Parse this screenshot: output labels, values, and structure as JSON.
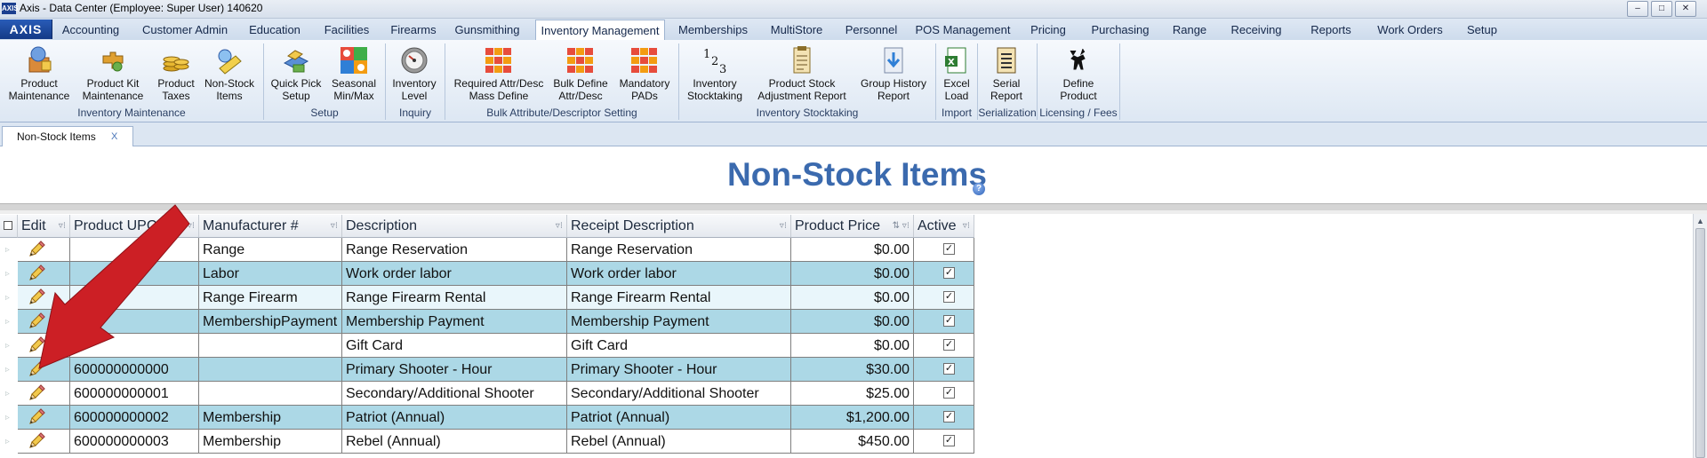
{
  "window": {
    "title": "Axis - Data Center  (Employee: Super User) 140620",
    "app_icon": "AXIS",
    "minimize": "–",
    "maximize": "□",
    "close": "✕"
  },
  "menu": {
    "axis_label": "AXIS",
    "tabs": [
      "Accounting",
      "Customer Admin",
      "Education",
      "Facilities",
      "Firearms",
      "Gunsmithing",
      "Inventory Management",
      "Memberships",
      "MultiStore",
      "Personnel",
      "POS Management",
      "Pricing",
      "Purchasing",
      "Range",
      "Receiving",
      "Reports",
      "Work Orders",
      "Setup"
    ],
    "active_tab": "Inventory Management"
  },
  "ribbon": {
    "buttons": [
      {
        "line1": "Product",
        "line2": "Maintenance",
        "icon": "product-maintenance-icon"
      },
      {
        "line1": "Product Kit",
        "line2": "Maintenance",
        "icon": "product-kit-icon"
      },
      {
        "line1": "Product",
        "line2": "Taxes",
        "icon": "coins-icon"
      },
      {
        "line1": "Non-Stock",
        "line2": "Items",
        "icon": "non-stock-items-icon"
      },
      {
        "line1": "Quick Pick",
        "line2": "Setup",
        "icon": "quick-pick-icon"
      },
      {
        "line1": "Seasonal",
        "line2": "Min/Max",
        "icon": "seasonal-icon"
      },
      {
        "line1": "Inventory",
        "line2": "Level",
        "icon": "gauge-icon"
      },
      {
        "line1": "Required Attr/Desc",
        "line2": "Mass Define",
        "icon": "grid-icon"
      },
      {
        "line1": "Bulk Define",
        "line2": "Attr/Desc",
        "icon": "grid-icon"
      },
      {
        "line1": "Mandatory",
        "line2": "PADs",
        "icon": "grid-icon"
      },
      {
        "line1": "Inventory",
        "line2": "Stocktaking",
        "icon": "numbers-icon"
      },
      {
        "line1": "Product Stock",
        "line2": "Adjustment Report",
        "icon": "report-icon"
      },
      {
        "line1": "Group History",
        "line2": "Report",
        "icon": "download-report-icon"
      },
      {
        "line1": "Excel",
        "line2": "Load",
        "icon": "excel-icon"
      },
      {
        "line1": "Serial",
        "line2": "Report",
        "icon": "serial-report-icon"
      },
      {
        "line1": "Define",
        "line2": "Product",
        "icon": "deer-icon"
      }
    ],
    "groups": [
      "Inventory Maintenance",
      "Setup",
      "Inquiry",
      "Bulk Attribute/Descriptor Setting",
      "Inventory Stocktaking",
      "Import",
      "Serialization",
      "Licensing / Fees"
    ]
  },
  "doc_tab": {
    "label": "Non-Stock Items",
    "close": "X"
  },
  "page": {
    "title": "Non-Stock Items",
    "help": "?"
  },
  "grid": {
    "columns": [
      "Edit",
      "Product UPC",
      "Manufacturer #",
      "Description",
      "Receipt Description",
      "Product Price",
      "Active"
    ],
    "rows": [
      {
        "upc": "",
        "mfr": "Range",
        "desc": "Range Reservation",
        "receipt": "Range Reservation",
        "price": "$0.00",
        "active": true
      },
      {
        "upc": "",
        "mfr": "Labor",
        "desc": "Work order labor",
        "receipt": "Work order labor",
        "price": "$0.00",
        "active": true
      },
      {
        "upc": "",
        "mfr": "Range Firearm",
        "desc": "Range Firearm Rental",
        "receipt": "Range Firearm Rental",
        "price": "$0.00",
        "active": true
      },
      {
        "upc": "",
        "mfr": "MembershipPayment",
        "desc": "Membership Payment",
        "receipt": "Membership Payment",
        "price": "$0.00",
        "active": true
      },
      {
        "upc": "",
        "mfr": "",
        "desc": "Gift Card",
        "receipt": "Gift Card",
        "price": "$0.00",
        "active": true
      },
      {
        "upc": "600000000000",
        "mfr": "",
        "desc": "Primary Shooter - Hour",
        "receipt": "Primary Shooter - Hour",
        "price": "$30.00",
        "active": true
      },
      {
        "upc": "600000000001",
        "mfr": "",
        "desc": "Secondary/Additional Shooter",
        "receipt": "Secondary/Additional Shooter",
        "price": "$25.00",
        "active": true
      },
      {
        "upc": "600000000002",
        "mfr": "Membership",
        "desc": "Patriot (Annual)",
        "receipt": "Patriot (Annual)",
        "price": "$1,200.00",
        "active": true
      },
      {
        "upc": "600000000003",
        "mfr": "Membership",
        "desc": "Rebel (Annual)",
        "receipt": "Rebel (Annual)",
        "price": "$450.00",
        "active": true
      }
    ]
  },
  "colors": {
    "row_blue": "#acd8e6",
    "row_light": "#e9f6fb",
    "row_white": "#ffffff",
    "title_blue": "#3b6aae",
    "arrow_red": "#cc1f25"
  }
}
